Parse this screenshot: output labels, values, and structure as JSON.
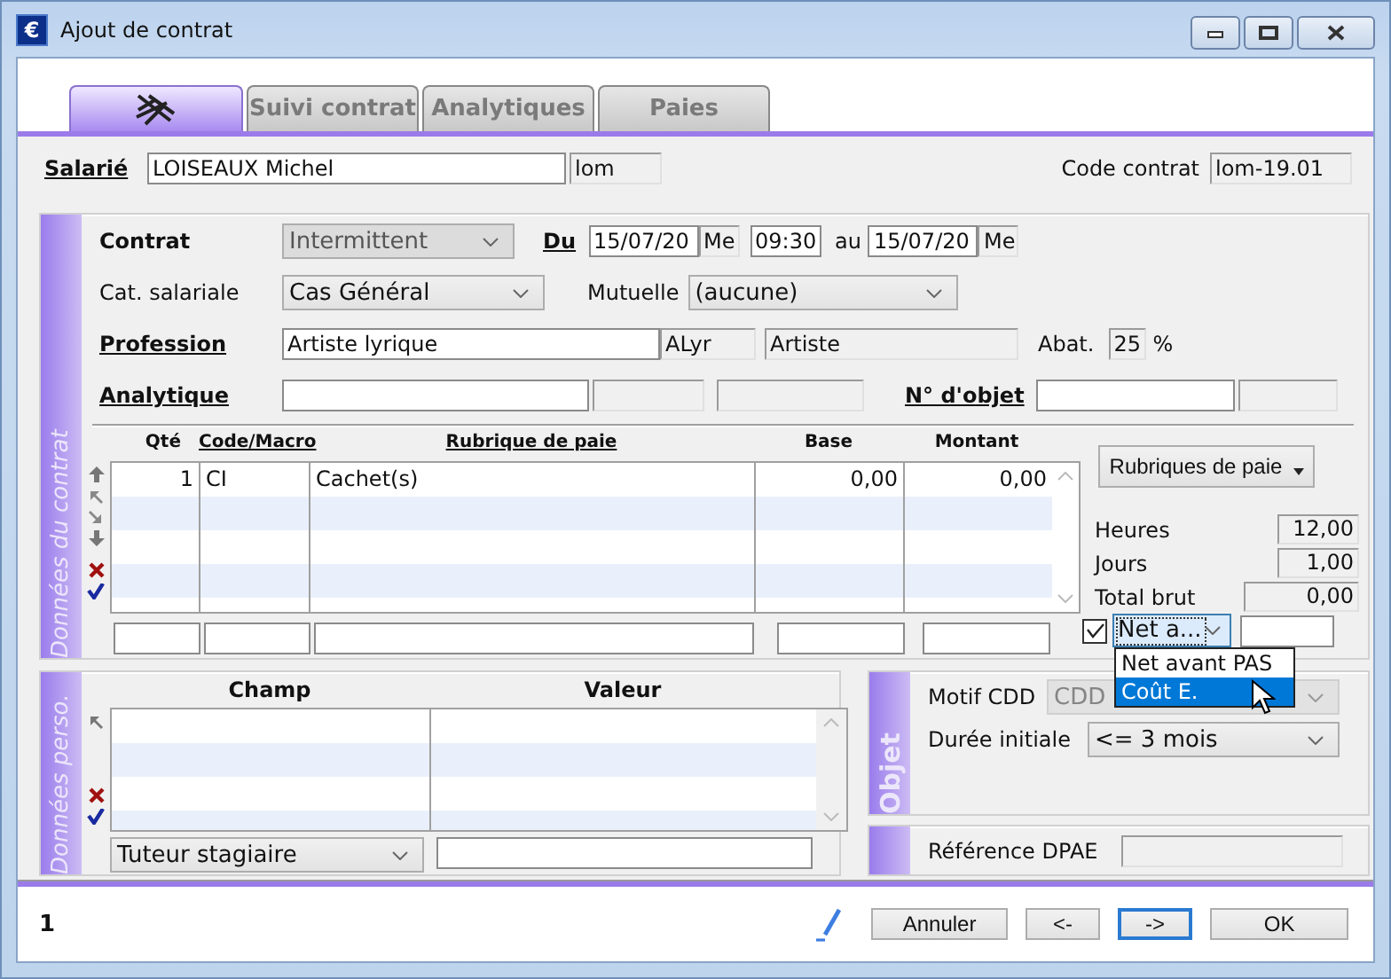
{
  "window": {
    "title": "Ajout de contrat",
    "icon_glyph": "€"
  },
  "tabs": [
    {
      "kind": "icon",
      "selected": true
    },
    {
      "kind": "text",
      "label": "Suivi contrat",
      "selected": false
    },
    {
      "kind": "text",
      "label": "Analytiques",
      "selected": false
    },
    {
      "kind": "text",
      "label": "Paies",
      "selected": false
    }
  ],
  "salarie": {
    "label": "Salarié",
    "name": "LOISEAUX Michel",
    "code": "lom"
  },
  "code_contrat": {
    "label": "Code contrat",
    "value": "lom-19.01"
  },
  "contract": {
    "title": "Données du contrat",
    "contrat": {
      "label": "Contrat",
      "value": "Intermittent",
      "disabled": true
    },
    "du": {
      "label": "Du",
      "date": "15/07/20",
      "day": "Me",
      "time": "09:30"
    },
    "au": {
      "label": "au",
      "date": "15/07/20",
      "day": "Me"
    },
    "cat": {
      "label": "Cat. salariale",
      "value": "Cas Général",
      "disabled": false
    },
    "mutuelle": {
      "label": "Mutuelle",
      "value": "(aucune)",
      "disabled": false
    },
    "profession": {
      "label": "Profession",
      "value": "Artiste lyrique",
      "code": "ALyr",
      "category": "Artiste"
    },
    "abat": {
      "label": "Abat.",
      "value": "25",
      "unit": "%"
    },
    "analytique": {
      "label": "Analytique"
    },
    "objet": {
      "label": "N° d'objet"
    },
    "grid": {
      "columns": [
        {
          "label": "Qté",
          "underlined": false
        },
        {
          "label": "Code/Macro",
          "underlined": true
        },
        {
          "label": "Rubrique de paie",
          "underlined": true
        },
        {
          "label": "Base",
          "underlined": false
        },
        {
          "label": "Montant",
          "underlined": false
        }
      ],
      "rows": [
        [
          "1",
          "CI",
          "Cachet(s)",
          "0,00",
          "0,00"
        ]
      ]
    },
    "rubriques_button": "Rubriques de paie",
    "totals": [
      {
        "label": "Heures",
        "value": "12,00"
      },
      {
        "label": "Jours",
        "value": "1,00"
      },
      {
        "label": "Total brut",
        "value": "0,00"
      }
    ],
    "net": {
      "checked": true,
      "value": "Net a...",
      "options": [
        {
          "label": "Net avant PAS",
          "selected": false
        },
        {
          "label": "Coût E.",
          "selected": true
        }
      ]
    }
  },
  "perso": {
    "title": "Données perso.",
    "columns": [
      "Champ",
      "Valeur"
    ],
    "field_select": "Tuteur stagiaire"
  },
  "objet_panel": {
    "title": "Objet",
    "motif": {
      "label": "Motif CDD",
      "value": "CDD",
      "disabled": true
    },
    "duree": {
      "label": "Durée initiale",
      "value": "<= 3 mois",
      "disabled": false
    }
  },
  "dpae": {
    "label": "Référence DPAE"
  },
  "status": "1",
  "buttons": [
    {
      "label": "Annuler",
      "focused": false
    },
    {
      "label": "<-",
      "focused": false
    },
    {
      "label": "->",
      "focused": true
    },
    {
      "label": "OK",
      "focused": false
    }
  ]
}
